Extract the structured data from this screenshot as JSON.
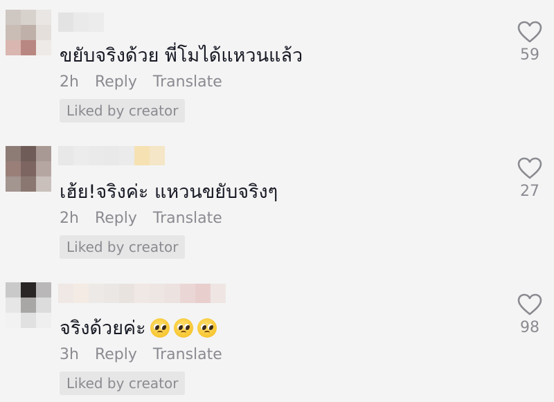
{
  "comments": [
    {
      "text": "ขยับจริงด้วย พี่โมได้แหวนแล้ว",
      "time": "2h",
      "reply_label": "Reply",
      "translate_label": "Translate",
      "badge": "Liked by creator",
      "likes": "59"
    },
    {
      "text": "เฮ้ย!จริงค่ะ แหวนขยับจริงๆ",
      "time": "2h",
      "reply_label": "Reply",
      "translate_label": "Translate",
      "badge": "Liked by creator",
      "likes": "27"
    },
    {
      "text": "จริงด้วยค่ะ",
      "emojis": [
        "pleading-face",
        "pleading-face",
        "pleading-face"
      ],
      "time": "3h",
      "reply_label": "Reply",
      "translate_label": "Translate",
      "badge": "Liked by creator",
      "likes": "98"
    }
  ],
  "icons": {
    "like": "heart-outline-icon",
    "emoji": "pleading-face-emoji"
  },
  "colors": {
    "background": "#f4f4f4",
    "text": "#161823",
    "secondary_text": "#8a8b91",
    "badge_background": "#e6e6e6"
  }
}
